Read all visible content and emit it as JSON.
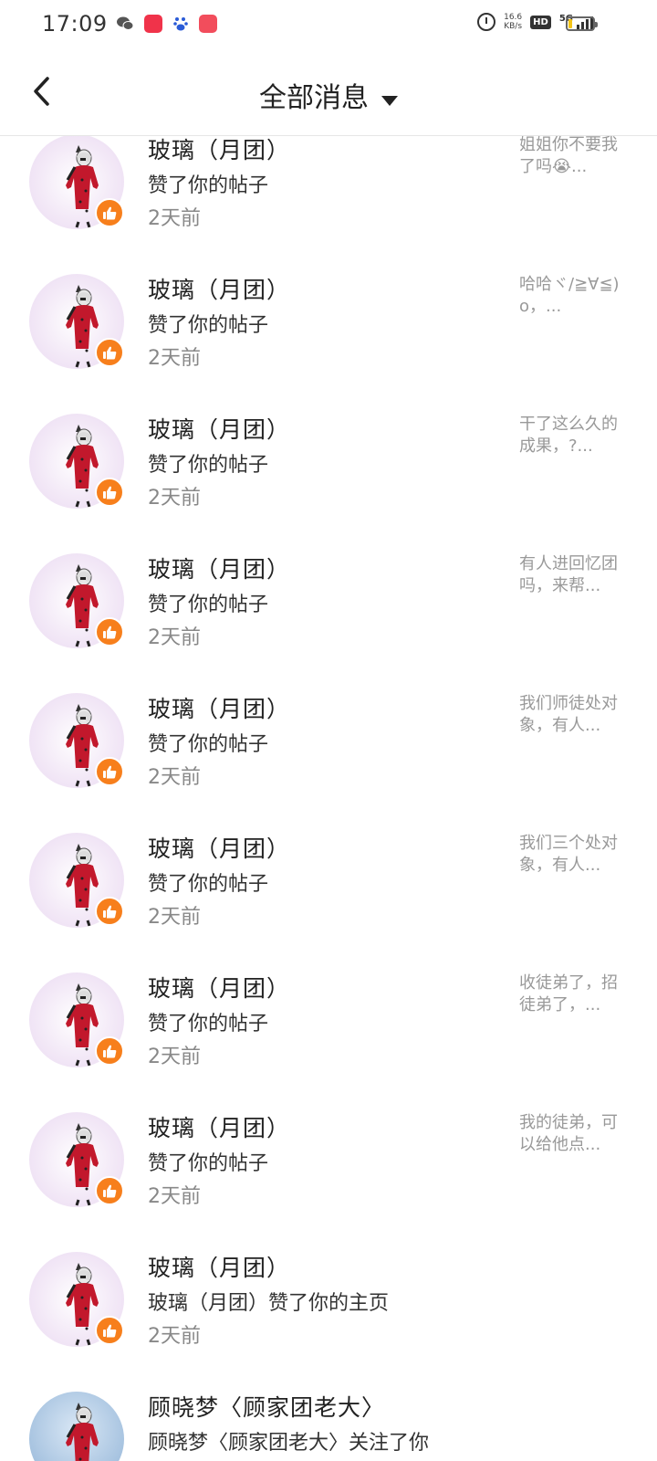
{
  "status_bar": {
    "time": "17:09",
    "net_speed_value": "16.6",
    "net_speed_unit": "KB/s",
    "hd_label": "HD",
    "network_label": "5G",
    "battery_level": 0.15,
    "app_icons": [
      "wechat-icon",
      "app-red-icon",
      "baidu-icon",
      "app-red2-icon"
    ]
  },
  "header": {
    "title": "全部消息"
  },
  "notifications": [
    {
      "name": "玻璃（月团）",
      "action": "赞了你的帖子",
      "time": "2天前",
      "preview": "姐姐你不要我了吗😭..."
    },
    {
      "name": "玻璃（月团）",
      "action": "赞了你的帖子",
      "time": "2天前",
      "preview": "哈哈ヾ/≧∀≦)o，..."
    },
    {
      "name": "玻璃（月团）",
      "action": "赞了你的帖子",
      "time": "2天前",
      "preview": "干了这么久的成果，?..."
    },
    {
      "name": "玻璃（月团）",
      "action": "赞了你的帖子",
      "time": "2天前",
      "preview": "有人进回忆团吗，来帮..."
    },
    {
      "name": "玻璃（月团）",
      "action": "赞了你的帖子",
      "time": "2天前",
      "preview": "我们师徒处对象，有人..."
    },
    {
      "name": "玻璃（月团）",
      "action": "赞了你的帖子",
      "time": "2天前",
      "preview": "我们三个处对象，有人..."
    },
    {
      "name": "玻璃（月团）",
      "action": "赞了你的帖子",
      "time": "2天前",
      "preview": "收徒弟了，招徒弟了，..."
    },
    {
      "name": "玻璃（月团）",
      "action": "赞了你的帖子",
      "time": "2天前",
      "preview": "我的徒弟，可以给他点..."
    },
    {
      "name": "玻璃（月团）",
      "action": "玻璃（月团）赞了你的主页",
      "time": "2天前",
      "preview": ""
    },
    {
      "name": "顾晓梦〈顾家团老大〉",
      "action": "顾晓梦〈顾家团老大〉关注了你",
      "time": "",
      "preview": ""
    }
  ],
  "colors": {
    "like_badge": "#f77f1c",
    "divider": "#e6e6e6",
    "time_text": "#888888",
    "preview_text": "#999999"
  }
}
